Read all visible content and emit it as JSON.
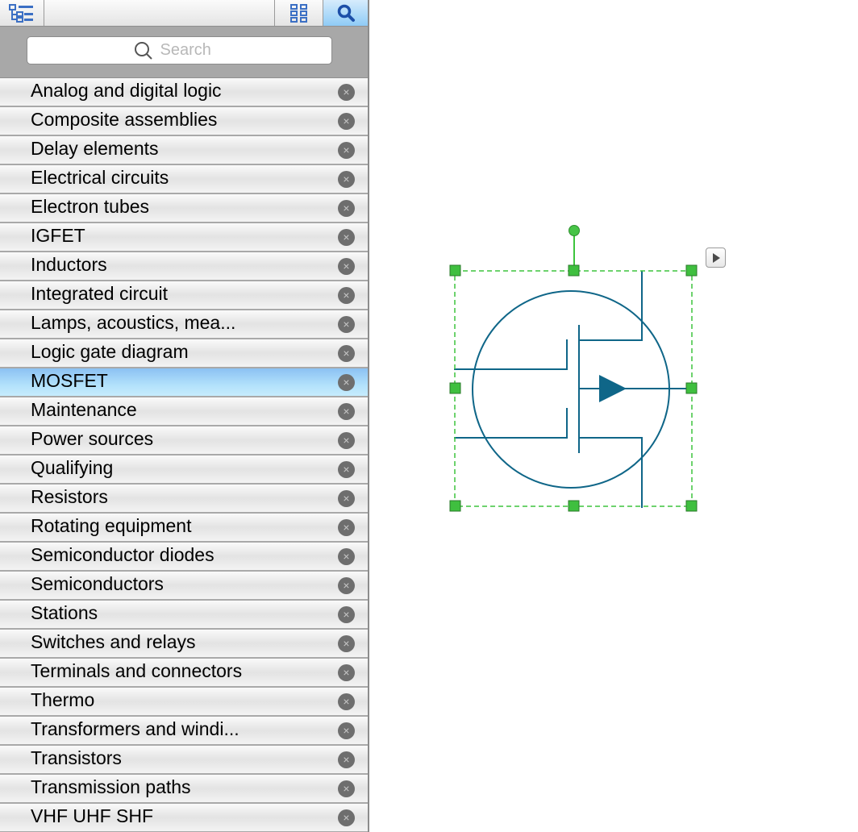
{
  "toolbar": {
    "tree_view": "tree-view-icon",
    "grid_view": "grid-view-icon",
    "search_view": "search-icon",
    "search_active_color": "#8fcbf6"
  },
  "search": {
    "placeholder": "Search",
    "value": ""
  },
  "library": {
    "selected_index": 10,
    "items": [
      {
        "label": "Analog and digital logic"
      },
      {
        "label": "Composite assemblies"
      },
      {
        "label": "Delay elements"
      },
      {
        "label": "Electrical circuits"
      },
      {
        "label": "Electron tubes"
      },
      {
        "label": "IGFET"
      },
      {
        "label": "Inductors"
      },
      {
        "label": "Integrated circuit"
      },
      {
        "label": "Lamps, acoustics, mea..."
      },
      {
        "label": "Logic gate diagram"
      },
      {
        "label": "MOSFET"
      },
      {
        "label": "Maintenance"
      },
      {
        "label": "Power sources"
      },
      {
        "label": "Qualifying"
      },
      {
        "label": "Resistors"
      },
      {
        "label": "Rotating equipment"
      },
      {
        "label": "Semiconductor diodes"
      },
      {
        "label": "Semiconductors"
      },
      {
        "label": "Stations"
      },
      {
        "label": "Switches and relays"
      },
      {
        "label": "Terminals and connectors"
      },
      {
        "label": "Thermo"
      },
      {
        "label": "Transformers and windi..."
      },
      {
        "label": "Transistors"
      },
      {
        "label": "Transmission paths"
      },
      {
        "label": "VHF UHF SHF"
      }
    ],
    "close_glyph": "×"
  },
  "canvas": {
    "shape": "mosfet-symbol",
    "stroke_color": "#0f6688",
    "selection_color": "#3db53d"
  }
}
